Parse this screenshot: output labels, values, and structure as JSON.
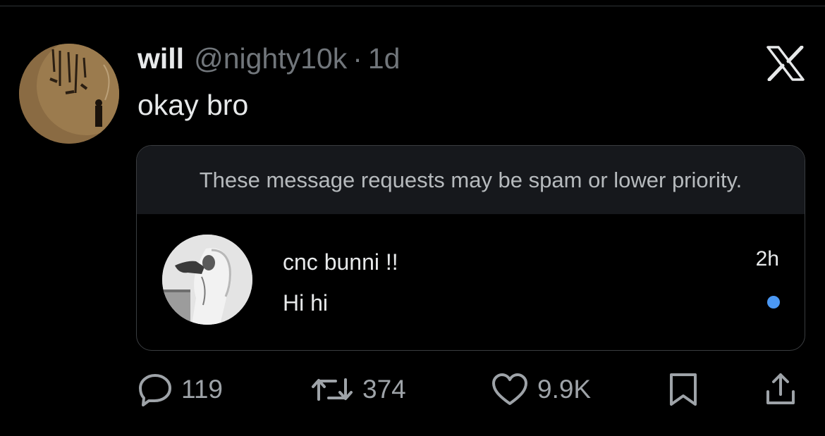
{
  "tweet": {
    "author_name": "will",
    "author_handle": "@nighty10k",
    "separator": "·",
    "time": "1d",
    "text": "okay bro"
  },
  "embed": {
    "banner_text": "These message requests may be spam or lower priority.",
    "dm": {
      "sender_name": "cnc bunni !!",
      "message": "Hi hi",
      "time": "2h",
      "unread": true
    }
  },
  "actions": {
    "replies": "119",
    "reposts": "374",
    "likes": "9.9K"
  },
  "icons": {
    "logo": "x-logo-icon",
    "reply": "reply-icon",
    "repost": "repost-icon",
    "like": "heart-icon",
    "bookmark": "bookmark-icon",
    "share": "share-icon"
  },
  "colors": {
    "background": "#000000",
    "text": "#e7e9ea",
    "secondary_text": "#71767b",
    "unread_dot": "#4b98f4",
    "banner_bg": "#16181c"
  }
}
